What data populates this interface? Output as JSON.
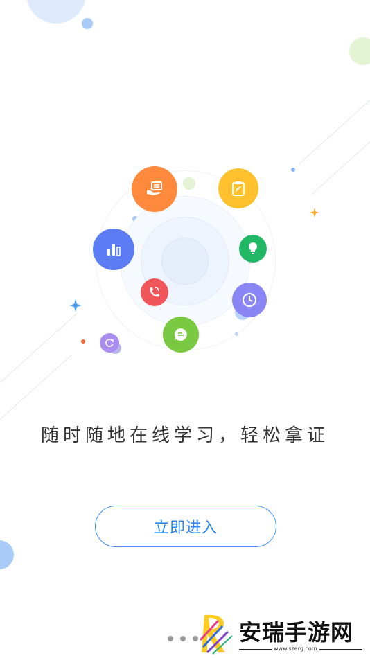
{
  "intro": {
    "tagline": "随时随地在线学习，轻松拿证",
    "enter_button_label": "立即进入"
  },
  "pager": {
    "total_visible_dots": 3
  },
  "feature_icons": [
    {
      "name": "certificate-hand-icon",
      "color": "#ff8a3d"
    },
    {
      "name": "clipboard-edit-icon",
      "color": "#ffc12e"
    },
    {
      "name": "bar-chart-icon",
      "color": "#5b7cf2"
    },
    {
      "name": "lightbulb-icon",
      "color": "#21b865"
    },
    {
      "name": "phone-callback-icon",
      "color": "#f0555a"
    },
    {
      "name": "clock-icon",
      "color": "#8a86f5"
    },
    {
      "name": "chat-message-icon",
      "color": "#7ac943"
    },
    {
      "name": "refresh-icon",
      "color": "#a98ef0"
    }
  ],
  "watermark": {
    "text": "安瑞手游网",
    "url": "www.szerg.com"
  },
  "colors": {
    "accent": "#3f8ff4",
    "tagline": "#333333"
  }
}
